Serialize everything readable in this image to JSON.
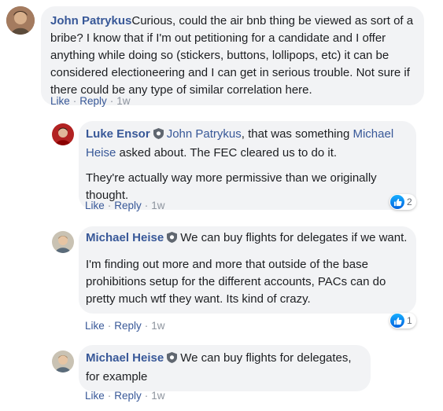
{
  "comments": [
    {
      "author": "John Patrykus",
      "text": "Curious, could the air bnb thing be viewed as sort of a bribe? I know that if I'm out petitioning for a candidate and I offer anything while doing so (stickers, buttons, lollipops, etc) it can be considered electioneering and I can get in serious trouble. Not sure if there could be any type of similar correlation here.",
      "like_label": "Like",
      "reply_label": "Reply",
      "time": "1w"
    },
    {
      "author": "Luke Ensor",
      "mention1": "John Patrykus",
      "text_a": ", that was something ",
      "mention2": "Michael Heise",
      "text_b": " asked about. The FEC cleared us to do it.",
      "text2": "They're actually way more permissive than we originally thought.",
      "like_label": "Like",
      "reply_label": "Reply",
      "time": "1w",
      "reaction_count": "2"
    },
    {
      "author": "Michael Heise",
      "text": "We can buy flights for delegates if we want.",
      "text2": "I'm finding out more and more that outside of the base prohibitions setup for the different accounts, PACs can do pretty much wtf they want. Its kind of crazy.",
      "like_label": "Like",
      "reply_label": "Reply",
      "time": "1w",
      "reaction_count": "1"
    },
    {
      "author": "Michael Heise",
      "text": "We can buy flights for delegates, for example",
      "like_label": "Like",
      "reply_label": "Reply",
      "time": "1w"
    }
  ],
  "icons": {
    "verified": "shield-icon",
    "reaction": "thumbs-up-icon"
  },
  "colors": {
    "link": "#385898",
    "bubble": "#f2f3f5",
    "meta": "#8d949e",
    "like_blue": "#1877f2"
  }
}
